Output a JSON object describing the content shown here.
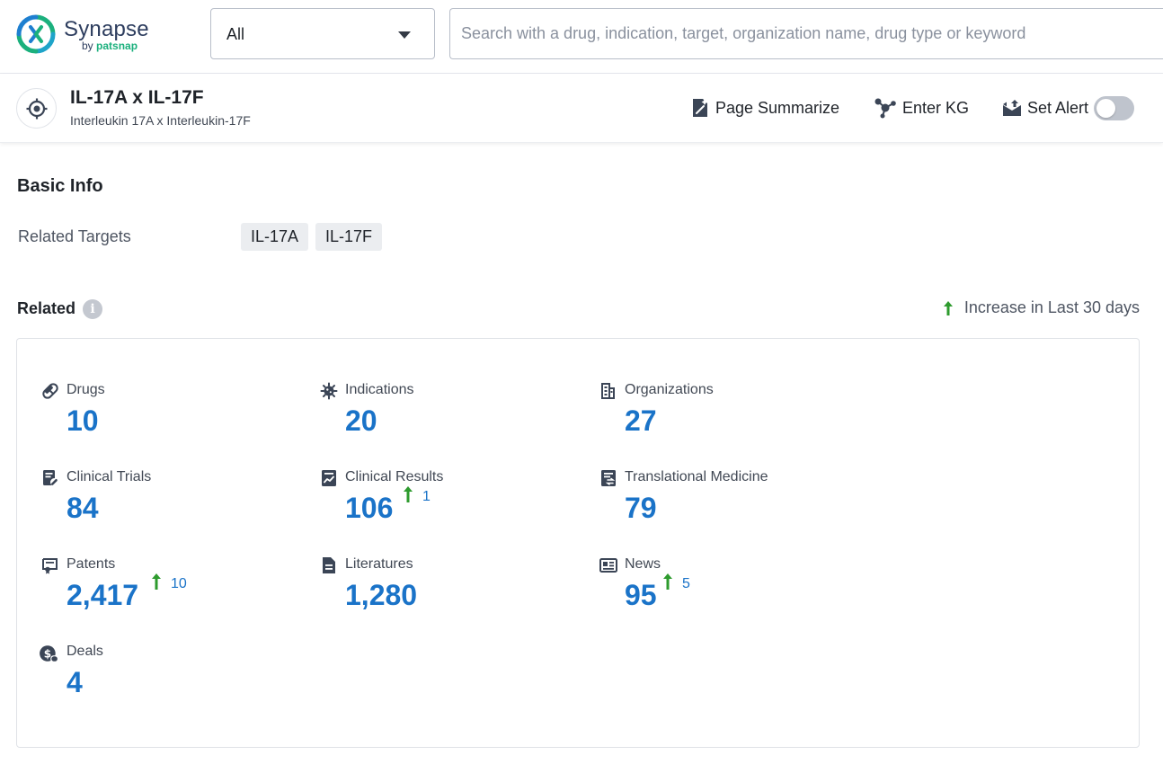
{
  "brand": {
    "name": "Synapse",
    "by_prefix": "by ",
    "by_brand": "patsnap",
    "accent": "#1bb07d"
  },
  "header": {
    "scope_select": {
      "value": "All"
    },
    "search": {
      "placeholder": "Search with a drug, indication, target, organization name, drug type or keyword",
      "value": ""
    }
  },
  "entity": {
    "icon": "target-icon",
    "title": "IL-17A x IL-17F",
    "subtitle": "Interleukin 17A x Interleukin-17F",
    "actions": {
      "page_summarize": "Page Summarize",
      "enter_kg": "Enter KG",
      "set_alert": "Set Alert"
    },
    "alert_enabled": false
  },
  "basic_info": {
    "heading": "Basic Info",
    "related_targets_label": "Related Targets",
    "related_targets": [
      "IL-17A",
      "IL-17F"
    ]
  },
  "related": {
    "heading": "Related",
    "legend": "Increase in Last 30 days",
    "increase_color": "#2e9b2e",
    "value_color": "#1a73c8",
    "stats": [
      {
        "label": "Drugs",
        "value": "10",
        "increase": "",
        "icon": "pill-icon"
      },
      {
        "label": "Indications",
        "value": "20",
        "increase": "",
        "icon": "virus-icon"
      },
      {
        "label": "Organizations",
        "value": "27",
        "increase": "",
        "icon": "building-icon"
      },
      {
        "label": "Clinical Trials",
        "value": "84",
        "increase": "",
        "icon": "clinical-trial-icon"
      },
      {
        "label": "Clinical Results",
        "value": "106",
        "increase": "1",
        "icon": "chart-report-icon"
      },
      {
        "label": "Translational Medicine",
        "value": "79",
        "increase": "",
        "icon": "translational-medicine-icon"
      },
      {
        "label": "Patents",
        "value": "2,417",
        "increase": "10",
        "icon": "patent-icon"
      },
      {
        "label": "Literatures",
        "value": "1,280",
        "increase": "",
        "icon": "document-icon"
      },
      {
        "label": "News",
        "value": "95",
        "increase": "5",
        "icon": "newspaper-icon"
      },
      {
        "label": "Deals",
        "value": "4",
        "increase": "",
        "icon": "deal-icon"
      }
    ]
  }
}
